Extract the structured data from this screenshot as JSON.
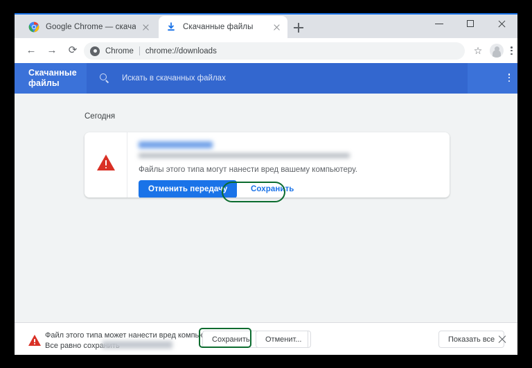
{
  "window": {
    "controls": {
      "minimize": "minimize",
      "maximize": "maximize",
      "close": "close"
    }
  },
  "tabs": [
    {
      "title": "Google Chrome — скачать бесп",
      "favicon": "chrome-logo-icon",
      "active": false
    },
    {
      "title": "Скачанные файлы",
      "favicon": "download-icon",
      "active": true
    }
  ],
  "new_tab_label": "+",
  "toolbar": {
    "back": "←",
    "forward": "→",
    "reload": "⟳",
    "origin_chip": "Chrome",
    "url": "chrome://downloads",
    "star": "☆"
  },
  "downloads_header": {
    "title": "Скачанные файлы",
    "search_placeholder": "Искать в скачанных файлах",
    "accent_color": "#3b72d9",
    "search_bg_color": "#3367cf"
  },
  "content": {
    "date_group_label": "Сегодня"
  },
  "download_card": {
    "filename_redacted": true,
    "url_redacted": true,
    "warning_text": "Файлы этого типа могут нанести вред вашему компьютеру.",
    "cancel_button": "Отменить передачу",
    "save_button": "Сохранить",
    "danger_color": "#d93025",
    "primary_button_color": "#1a73e8"
  },
  "download_shelf": {
    "warning_line1": "Файл этого типа может нанести вред компьютеру.",
    "warning_line2": "Все равно сохранить",
    "filename_redacted": true,
    "save_button": "Сохранить",
    "cancel_button": "Отменит...",
    "show_all_button": "Показать все",
    "close": "×"
  },
  "annotations": {
    "highlight_color": "#0b6b2e",
    "items": [
      {
        "target": "card-save-button"
      },
      {
        "target": "shelf-save-button"
      }
    ]
  }
}
